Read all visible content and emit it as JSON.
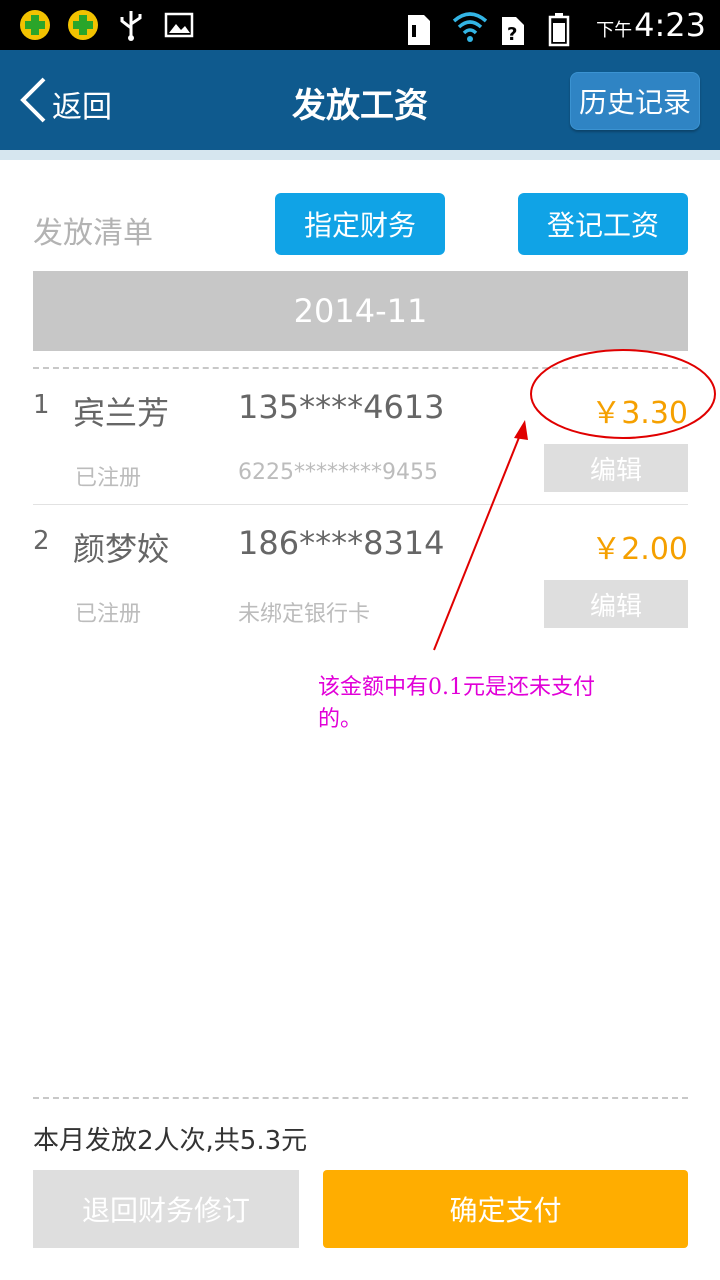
{
  "status_bar": {
    "icons": [
      "app-plus-icon",
      "app-plus-icon",
      "usb-icon",
      "image-icon",
      "sd-card-icon",
      "wifi-icon",
      "no-sim-icon",
      "battery-icon"
    ],
    "ampm": "下午",
    "time": "4:23"
  },
  "header": {
    "back_label": "返回",
    "title": "发放工资",
    "history_label": "历史记录"
  },
  "toolbar": {
    "list_title": "发放清单",
    "assign_label": "指定财务",
    "register_label": "登记工资"
  },
  "month": "2014-11",
  "rows": [
    {
      "index": "1",
      "name": "宾兰芳",
      "phone": "135****4613",
      "amount": "￥3.30",
      "status": "已注册",
      "card": "6225********9455",
      "edit_label": "编辑"
    },
    {
      "index": "2",
      "name": "颜梦姣",
      "phone": "186****8314",
      "amount": "￥2.00",
      "status": "已注册",
      "card": "未绑定银行卡",
      "edit_label": "编辑"
    }
  ],
  "annotation": {
    "text": "该金额中有0.1元是还未支付的。",
    "color": "#e100d8",
    "marker_color": "#e00000"
  },
  "summary": "本月发放2人次,共5.3元",
  "footer": {
    "revise_label": "退回财务修订",
    "pay_label": "确定支付"
  },
  "colors": {
    "header_bg": "#0f5a8e",
    "accent_blue": "#10a3e6",
    "amount": "#f5a000",
    "pay_button": "#ffad00"
  }
}
